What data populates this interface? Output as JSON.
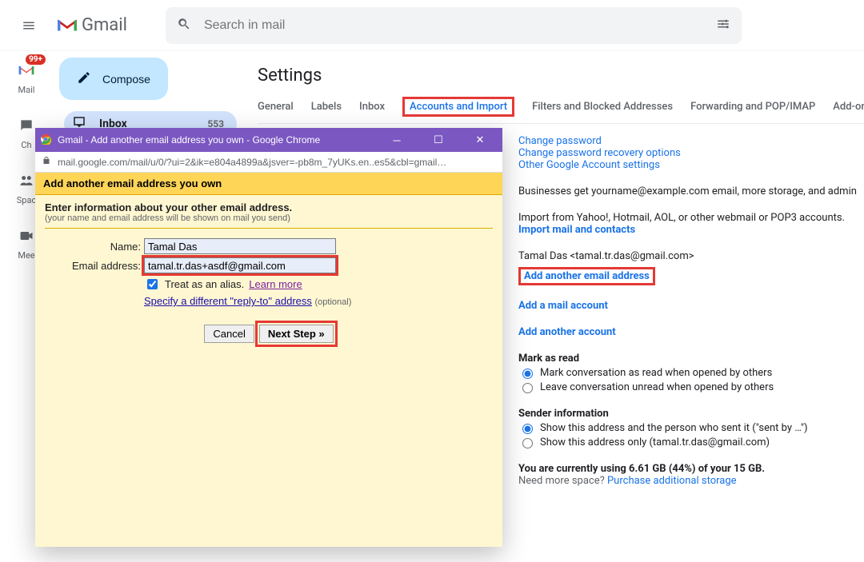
{
  "topbar": {
    "logo_text": "Gmail",
    "search_placeholder": "Search in mail"
  },
  "leftrail": {
    "mail": "Mail",
    "mail_badge": "99+",
    "chat": "Ch",
    "spaces": "Spac",
    "meet": "Mee"
  },
  "sidebar": {
    "compose": "Compose",
    "inbox_label": "Inbox",
    "inbox_count": "553"
  },
  "settings": {
    "title": "Settings",
    "tabs": {
      "general": "General",
      "labels": "Labels",
      "inbox": "Inbox",
      "accounts": "Accounts and Import",
      "filters": "Filters and Blocked Addresses",
      "forwarding": "Forwarding and POP/IMAP",
      "addons": "Add-ons"
    },
    "links": {
      "change_pw": "Change password",
      "change_rec": "Change password recovery options",
      "other_google": "Other Google Account settings",
      "business_text": "Businesses get yourname@example.com email, more storage, and admin",
      "import_text": "Import from Yahoo!, Hotmail, AOL, or other webmail or POP3 accounts.",
      "import_link": "Import mail and contacts",
      "owner": "Tamal Das <tamal.tr.das@gmail.com>",
      "add_another_email": "Add another email address",
      "add_mail_account": "Add a mail account",
      "add_another_account": "Add another account",
      "mark_as_read": "Mark as read",
      "mark_r1": "Mark conversation as read when opened by others",
      "mark_r2": "Leave conversation unread when opened by others",
      "sender_info": "Sender information",
      "sender_r1": "Show this address and the person who sent it (\"sent by …\")",
      "sender_r2": "Show this address only (tamal.tr.das@gmail.com)",
      "storage_line": "You are currently using 6.61 GB (44%) of your 15 GB.",
      "storage_q": "Need more space? ",
      "storage_link": "Purchase additional storage"
    }
  },
  "popup": {
    "window_title": "Gmail - Add another email address you own - Google Chrome",
    "url": "mail.google.com/mail/u/0/?ui=2&ik=e804a4899a&jsver=-pb8m_7yUKs.en..es5&cbl=gmail…",
    "header": "Add another email address you own",
    "intro": "Enter information about your other email address.",
    "sub": "(your name and email address will be shown on mail you send)",
    "name_label": "Name:",
    "name_value": "Tamal Das",
    "email_label": "Email address:",
    "email_value": "tamal.tr.das+asdf@gmail.com",
    "alias_label": "Treat as an alias.",
    "learn_more": "Learn more",
    "reply_to": "Specify a different \"reply-to\" address",
    "optional": "(optional)",
    "cancel": "Cancel",
    "next": "Next Step »"
  }
}
